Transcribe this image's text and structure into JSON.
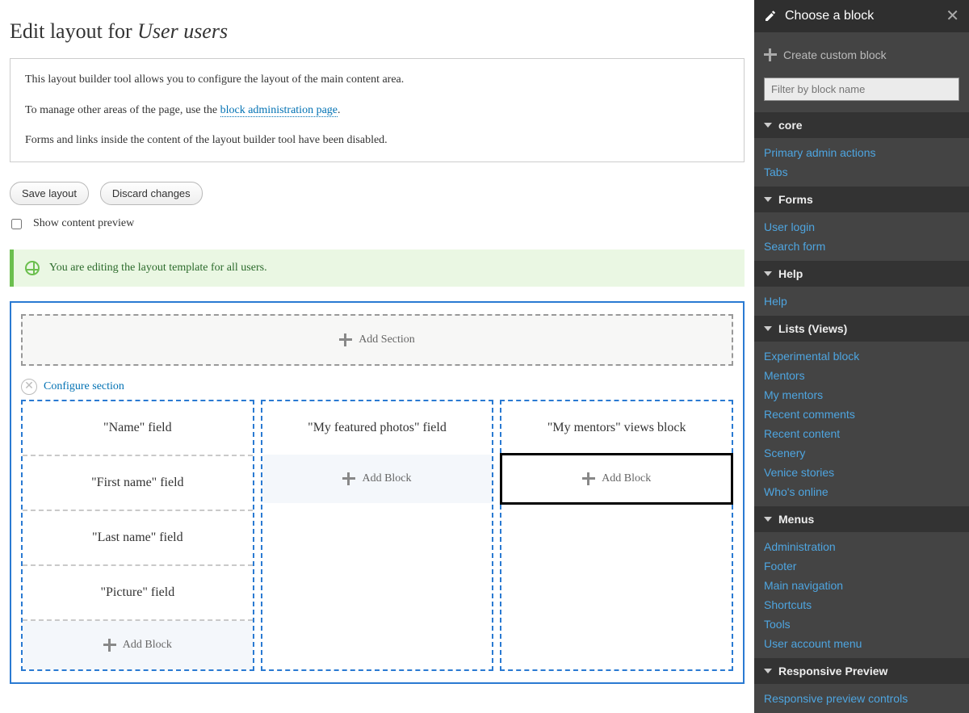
{
  "page": {
    "title_prefix": "Edit layout for ",
    "title_em": "User users"
  },
  "info": {
    "p1": "This layout builder tool allows you to configure the layout of the main content area.",
    "p2_prefix": "To manage other areas of the page, use the ",
    "p2_link": "block administration page",
    "p2_suffix": ".",
    "p3": "Forms and links inside the content of the layout builder tool have been disabled."
  },
  "buttons": {
    "save": "Save layout",
    "discard": "Discard changes"
  },
  "preview_label": "Show content preview",
  "status": "You are editing the layout template for all users.",
  "add_section": "Add Section",
  "configure_section": "Configure section",
  "add_block": "Add Block",
  "columns": {
    "col1": [
      "\"Name\" field",
      "\"First name\" field",
      "\"Last name\" field",
      "\"Picture\" field"
    ],
    "col2": [
      "\"My featured photos\" field"
    ],
    "col3": [
      "\"My mentors\" views block"
    ]
  },
  "offcanvas": {
    "title": "Choose a block",
    "create": "Create custom block",
    "filter_placeholder": "Filter by block name",
    "groups": [
      {
        "name": "core",
        "items": [
          "Primary admin actions",
          "Tabs"
        ]
      },
      {
        "name": "Forms",
        "items": [
          "User login",
          "Search form"
        ]
      },
      {
        "name": "Help",
        "items": [
          "Help"
        ]
      },
      {
        "name": "Lists (Views)",
        "items": [
          "Experimental block",
          "Mentors",
          "My mentors",
          "Recent comments",
          "Recent content",
          "Scenery",
          "Venice stories",
          "Who's online"
        ]
      },
      {
        "name": "Menus",
        "items": [
          "Administration",
          "Footer",
          "Main navigation",
          "Shortcuts",
          "Tools",
          "User account menu"
        ]
      },
      {
        "name": "Responsive Preview",
        "items": [
          "Responsive preview controls"
        ]
      }
    ]
  }
}
